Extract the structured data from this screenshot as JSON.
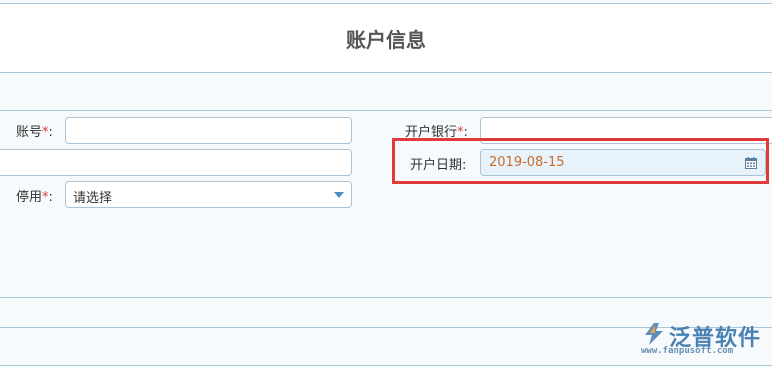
{
  "header": {
    "title": "账户信息"
  },
  "form": {
    "account_no": {
      "label": "账号",
      "required_mark": "*",
      "colon": ":",
      "value": ""
    },
    "blank_field": {
      "value": ""
    },
    "disabled": {
      "label": "停用",
      "required_mark": "*",
      "colon": ":",
      "selected": "请选择"
    },
    "bank": {
      "label": "开户银行",
      "required_mark": "*",
      "colon": ":",
      "value": ""
    },
    "open_date": {
      "label": "开户日期:",
      "value": "2019-08-15"
    }
  },
  "colors": {
    "highlight": "#e03a3a",
    "accent": "#4a90c8",
    "date_text": "#c96a2a"
  },
  "icons": {
    "calendar": "calendar-icon",
    "dropdown": "chevron-down-icon",
    "logo": "fanpu-logo-icon"
  },
  "watermark": {
    "brand": "泛普软件",
    "url": "www.fanpusoft.com"
  }
}
